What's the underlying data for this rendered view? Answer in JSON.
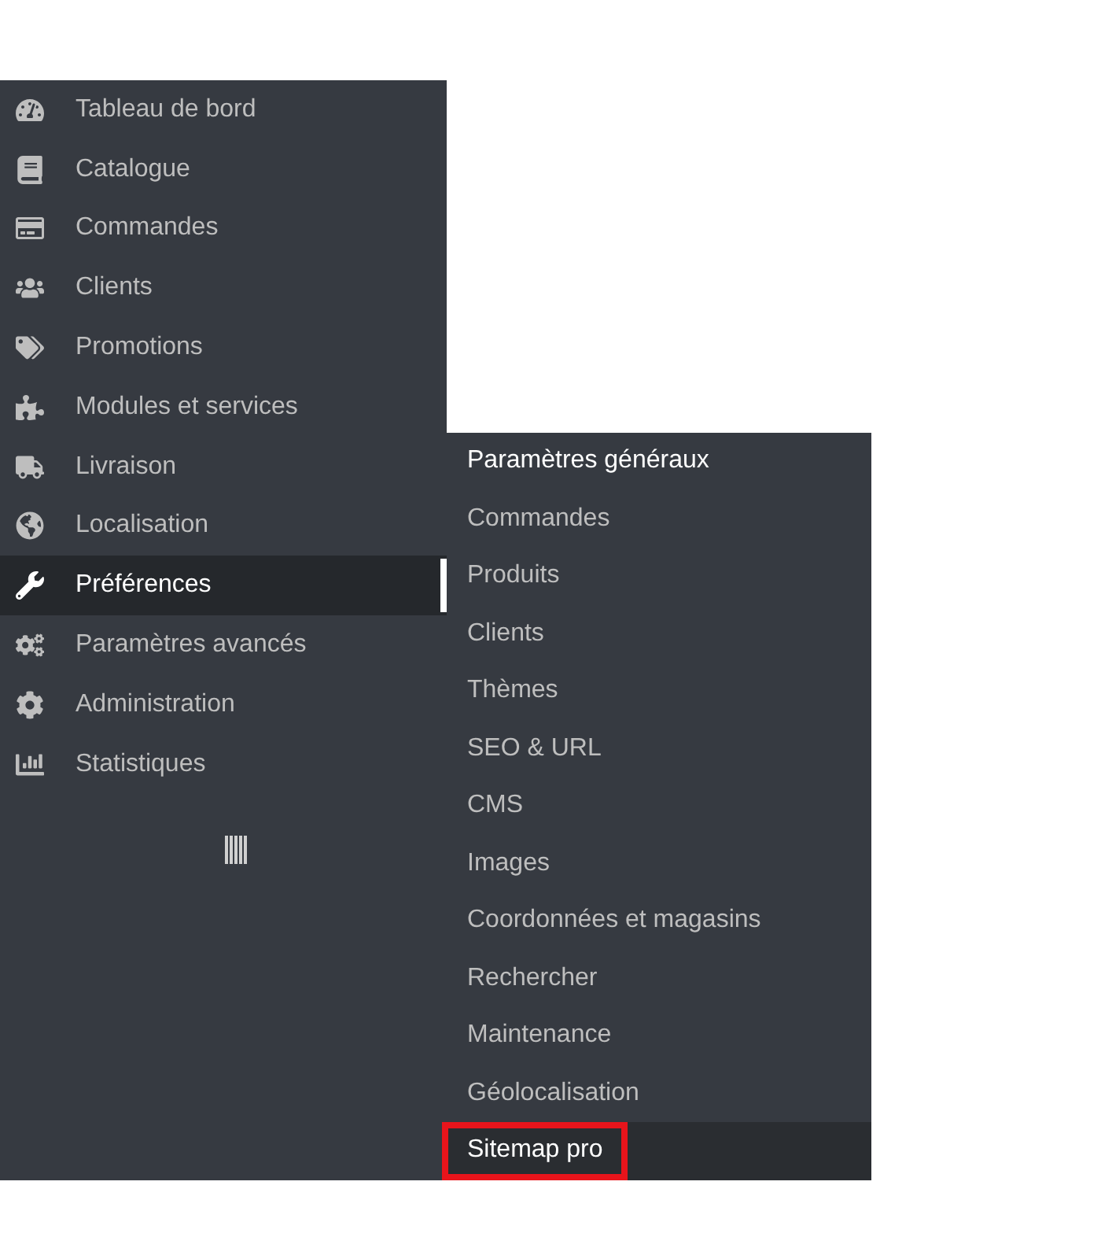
{
  "sidebar": {
    "items": [
      {
        "label": "Tableau de bord",
        "selected": false
      },
      {
        "label": "Catalogue",
        "selected": false
      },
      {
        "label": "Commandes",
        "selected": false
      },
      {
        "label": "Clients",
        "selected": false
      },
      {
        "label": "Promotions",
        "selected": false
      },
      {
        "label": "Modules et services",
        "selected": false
      },
      {
        "label": "Livraison",
        "selected": false
      },
      {
        "label": "Localisation",
        "selected": false
      },
      {
        "label": "Préférences",
        "selected": true
      },
      {
        "label": "Paramètres avancés",
        "selected": false
      },
      {
        "label": "Administration",
        "selected": false
      },
      {
        "label": "Statistiques",
        "selected": false
      }
    ]
  },
  "submenu": {
    "items": [
      {
        "label": "Paramètres généraux",
        "selected": true,
        "highlighted": false
      },
      {
        "label": "Commandes",
        "selected": false,
        "highlighted": false
      },
      {
        "label": "Produits",
        "selected": false,
        "highlighted": false
      },
      {
        "label": "Clients",
        "selected": false,
        "highlighted": false
      },
      {
        "label": "Thèmes",
        "selected": false,
        "highlighted": false
      },
      {
        "label": "SEO & URL",
        "selected": false,
        "highlighted": false
      },
      {
        "label": "CMS",
        "selected": false,
        "highlighted": false
      },
      {
        "label": "Images",
        "selected": false,
        "highlighted": false
      },
      {
        "label": "Coordonnées et magasins",
        "selected": false,
        "highlighted": false
      },
      {
        "label": "Rechercher",
        "selected": false,
        "highlighted": false
      },
      {
        "label": "Maintenance",
        "selected": false,
        "highlighted": false
      },
      {
        "label": "Géolocalisation",
        "selected": false,
        "highlighted": false
      },
      {
        "label": "Sitemap pro",
        "selected": true,
        "highlighted": true
      }
    ]
  }
}
